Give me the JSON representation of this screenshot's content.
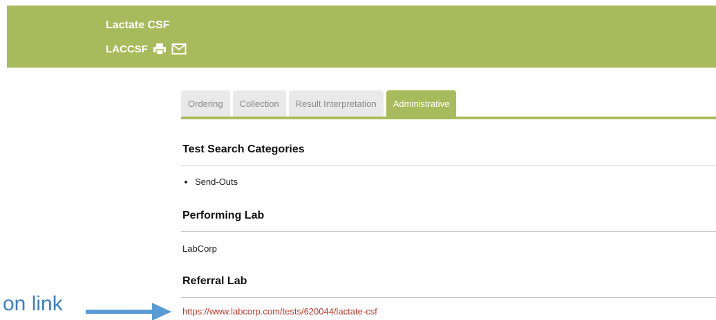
{
  "header": {
    "title": "Lactate CSF",
    "code": "LACCSF",
    "colors": {
      "header_bg": "#a8bb5c",
      "text": "#ffffff"
    },
    "icons": [
      "print-icon",
      "envelope-icon"
    ]
  },
  "tabs": [
    {
      "label": "Ordering",
      "active": false
    },
    {
      "label": "Collection",
      "active": false
    },
    {
      "label": "Result Interpretation",
      "active": false
    },
    {
      "label": "Administrative",
      "active": true
    }
  ],
  "sections": {
    "test_search_categories": {
      "heading": "Test Search Categories",
      "items": [
        "Send-Outs"
      ]
    },
    "performing_lab": {
      "heading": "Performing Lab",
      "value": "LabCorp"
    },
    "referral_lab": {
      "heading": "Referral Lab",
      "link": "https://www.labcorp.com/tests/620044/lactate-csf"
    }
  },
  "annotation": {
    "label": "on link",
    "color": "#3d7fc4"
  },
  "colors": {
    "accent": "#a8bb5c",
    "link": "#c0392b",
    "tab_inactive_bg": "#e9e9e9",
    "tab_inactive_text": "#8a8a8a"
  }
}
